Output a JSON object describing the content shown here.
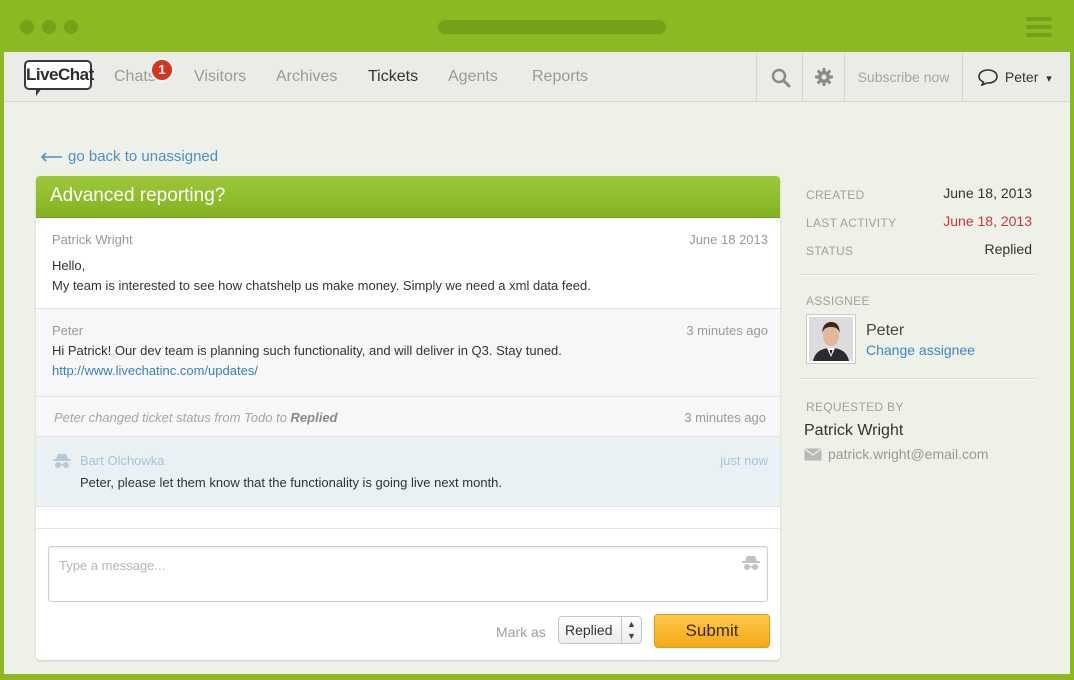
{
  "nav": {
    "logo": "LiveChat",
    "items": [
      {
        "label": "Chats",
        "badge": "1"
      },
      {
        "label": "Visitors"
      },
      {
        "label": "Archives"
      },
      {
        "label": "Tickets",
        "active": true
      },
      {
        "label": "Agents"
      },
      {
        "label": "Reports"
      }
    ],
    "search_icon": "search-icon",
    "settings_icon": "gear-icon",
    "subscribe_label": "Subscribe now",
    "user_label": "Peter",
    "user_caret": "▾"
  },
  "back_link": "go back to unassigned",
  "ticket": {
    "title": "Advanced reporting?",
    "messages": [
      {
        "author": "Patrick Wright",
        "time": "June 18 2013",
        "line1": "Hello,",
        "line2": "My team is interested to see how chatshelp us make money. Simply we need a xml data feed."
      },
      {
        "author": "Peter",
        "time": "3 minutes ago",
        "line1": "Hi Patrick! Our dev team is planning such functionality, and will deliver in Q3. Stay tuned.",
        "link": "http://www.livechatinc.com/updates/"
      }
    ],
    "status_change": {
      "prefix": "Peter changed ticket status from Todo to ",
      "status": "Replied",
      "time": "3 minutes ago"
    },
    "private_note": {
      "author": "Bart Olchowka",
      "time": "just now",
      "text": "Peter, please let them know that the functionality is going live next month."
    },
    "composer_placeholder": "Type a message...",
    "mark_as_label": "Mark as",
    "mark_as_value": "Replied",
    "submit_label": "Submit"
  },
  "details": {
    "created_label": "CREATED",
    "created_value": "June 18, 2013",
    "last_activity_label": "LAST ACTIVITY",
    "last_activity_value": "June 18, 2013",
    "status_label": "STATUS",
    "status_value": "Replied",
    "assignee_label": "ASSIGNEE",
    "assignee_name": "Peter",
    "change_assignee": "Change assignee",
    "requested_by_label": "REQUESTED BY",
    "requester_name": "Patrick Wright",
    "requester_email": "patrick.wright@email.com"
  },
  "colors": {
    "brand_green": "#8cb824",
    "link_blue": "#3a86c8",
    "alert_red": "#c6373a",
    "submit_orange": "#f5a718"
  }
}
